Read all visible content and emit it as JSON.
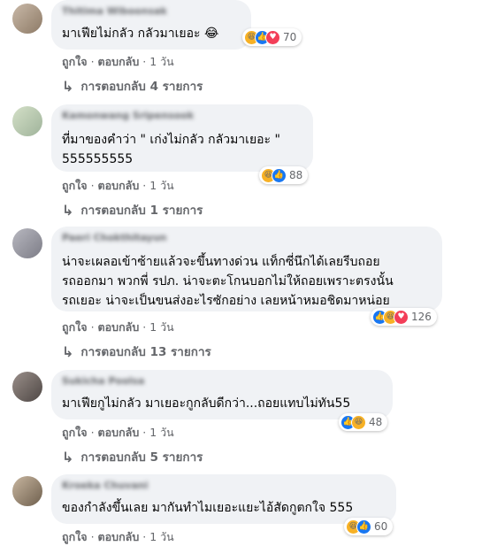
{
  "comments": [
    {
      "author": "Thitima Wiboonsak",
      "lines": [
        "มาเฟียไม่กลัว กลัวมาเยอะ 😂"
      ],
      "reactions": [
        "haha",
        "like",
        "love"
      ],
      "reaction_count": "70",
      "actions": {
        "like": "ถูกใจ",
        "reply": "ตอบกลับ",
        "sep": "·",
        "time": "1 วัน"
      },
      "replies": "การตอบกลับ 4 รายการ"
    },
    {
      "author": "Kamonwang Sripensook",
      "lines": [
        "ที่มาของคำว่า \" เก่งไม่กลัว กลัวมาเยอะ \"",
        "555555555"
      ],
      "reactions": [
        "haha",
        "like"
      ],
      "reaction_count": "88",
      "actions": {
        "like": "ถูกใจ",
        "reply": "ตอบกลับ",
        "sep": "·",
        "time": "1 วัน"
      },
      "replies": "การตอบกลับ 1 รายการ"
    },
    {
      "author": "Paeri Chokthitayun",
      "lines": [
        "น่าจะเผลอเข้าซ้ายแล้วจะขึ้นทางด่วน แท็กซี่นึกได้เลยรีบถอย",
        "รถออกมา พวกพี่ รปภ. น่าจะตะโกนบอกไม่ให้ถอยเพราะตรงนั้น",
        "รถเยอะ น่าจะเป็นขนส่งอะไรซักอย่าง เลยหน้าหมอชิดมาหน่อย"
      ],
      "reactions": [
        "like",
        "haha",
        "love"
      ],
      "reaction_count": "126",
      "actions": {
        "like": "ถูกใจ",
        "reply": "ตอบกลับ",
        "sep": "·",
        "time": "1 วัน"
      },
      "replies": "การตอบกลับ 13 รายการ"
    },
    {
      "author": "Sukicha Poolsa",
      "lines": [
        "มาเฟียกูไม่กลัว มาเยอะกูกลับดีกว่า...ถอยแทบไม่ทัน55"
      ],
      "reactions": [
        "like",
        "haha"
      ],
      "reaction_count": "48",
      "actions": {
        "like": "ถูกใจ",
        "reply": "ตอบกลับ",
        "sep": "·",
        "time": "1 วัน"
      },
      "replies": "การตอบกลับ 5 รายการ"
    },
    {
      "author": "Kroeka Chuvani",
      "lines": [
        "ของกำลังขึ้นเลย มากันทำไมเยอะแยะไอ้สัดกูตกใจ 555"
      ],
      "reactions": [
        "haha",
        "like"
      ],
      "reaction_count": "60",
      "actions": {
        "like": "ถูกใจ",
        "reply": "ตอบกลับ",
        "sep": "·",
        "time": "1 วัน"
      },
      "replies": ""
    }
  ],
  "reaction_icons": {
    "haha": "😆",
    "like": "👍",
    "love": "♥"
  },
  "colors": {
    "bubble": "#f0f2f5",
    "meta": "#65676b",
    "like": "#1877f2",
    "love": "#f33e58",
    "haha": "#f7b125"
  }
}
